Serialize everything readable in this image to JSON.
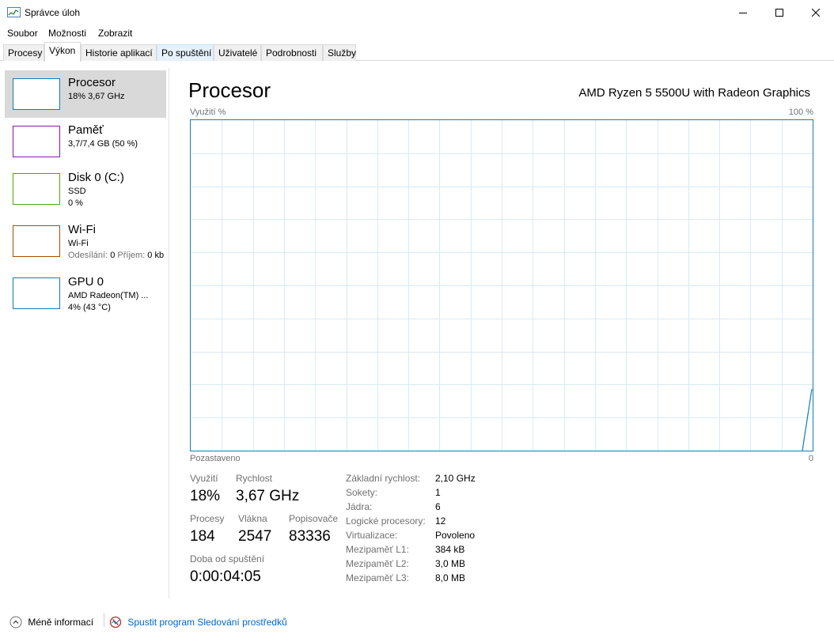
{
  "window": {
    "title": "Správce úloh"
  },
  "menu": [
    "Soubor",
    "Možnosti",
    "Zobrazit"
  ],
  "tabs": [
    {
      "label": "Procesy"
    },
    {
      "label": "Výkon"
    },
    {
      "label": "Historie aplikací"
    },
    {
      "label": "Po spuštění"
    },
    {
      "label": "Uživatelé"
    },
    {
      "label": "Podrobnosti"
    },
    {
      "label": "Služby"
    }
  ],
  "sidebar": {
    "items": [
      {
        "name": "Procesor",
        "line1": "18% 3,67 GHz",
        "color": "#117dbb"
      },
      {
        "name": "Paměť",
        "line1": "3,7/7,4 GB (50 %)",
        "color": "#8b12ae"
      },
      {
        "name": "Disk 0 (C:)",
        "line1": "SSD",
        "line2": "0 %",
        "color": "#4da60c"
      },
      {
        "name": "Wi-Fi",
        "line1": "Wi-Fi",
        "line2_label1": "Odesílání:",
        "line2_val1": "0",
        "line2_label2": "Příjem:",
        "line2_val2": "0 kb",
        "color": "#a74f01"
      },
      {
        "name": "GPU 0",
        "line1": "AMD Radeon(TM) ...",
        "line2": "4% (43 °C)",
        "color": "#117dbb"
      }
    ]
  },
  "main": {
    "title": "Procesor",
    "cpu_model": "AMD Ryzen 5 5500U with Radeon Graphics",
    "graph": {
      "top_left_label": "Využití %",
      "top_right_label": "100 %",
      "bottom_left_label": "Pozastaveno",
      "bottom_right_label": "0",
      "line_color": "#117dbb",
      "grid_color": "#d9eaf4"
    },
    "stats": {
      "utilization_label": "Využití",
      "utilization_value": "18%",
      "speed_label": "Rychlost",
      "speed_value": "3,67 GHz",
      "processes_label": "Procesy",
      "processes_value": "184",
      "threads_label": "Vlákna",
      "threads_value": "2547",
      "handles_label": "Popisovače",
      "handles_value": "83336",
      "uptime_label": "Doba od spuštění",
      "uptime_value": "0:00:04:05"
    },
    "specs": [
      {
        "label": "Základní rychlost:",
        "value": "2,10 GHz"
      },
      {
        "label": "Sokety:",
        "value": "1"
      },
      {
        "label": "Jádra:",
        "value": "6"
      },
      {
        "label": "Logické procesory:",
        "value": "12"
      },
      {
        "label": "Virtualizace:",
        "value": "Povoleno"
      },
      {
        "label": "Mezipaměť L1:",
        "value": "384 kB"
      },
      {
        "label": "Mezipaměť L2:",
        "value": "3,0 MB"
      },
      {
        "label": "Mezipaměť L3:",
        "value": "8,0 MB"
      }
    ]
  },
  "footer": {
    "less_info": "Méně informací",
    "resource_monitor": "Spustit program Sledování prostředků"
  }
}
